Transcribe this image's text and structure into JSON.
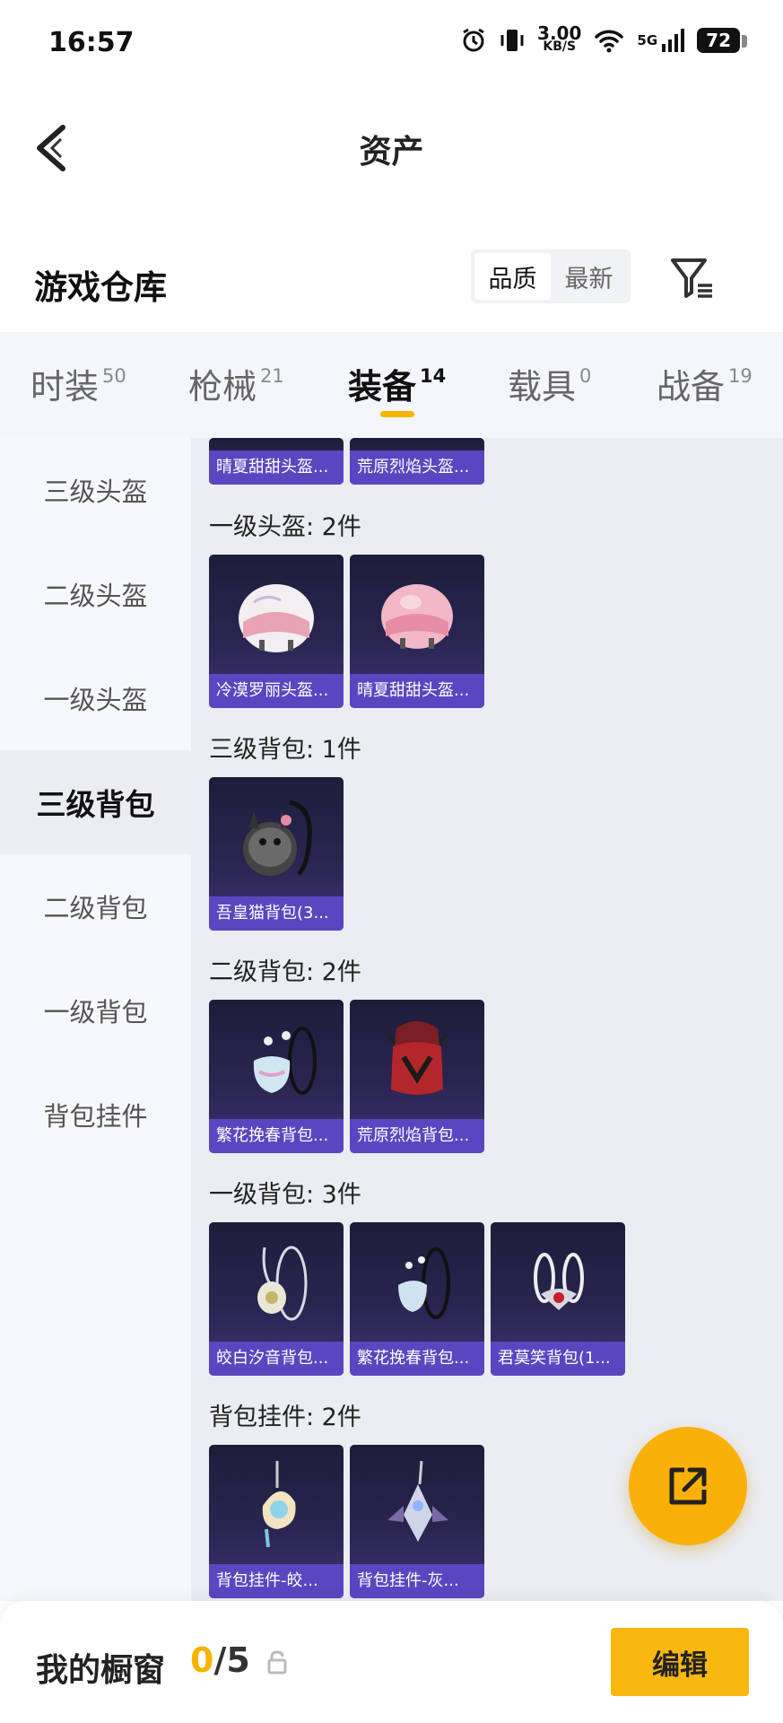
{
  "status_bar": {
    "time": "16:57",
    "speed_value": "3.00",
    "speed_unit": "KB/S",
    "network": "5G",
    "battery": "72"
  },
  "header": {
    "title": "资产",
    "back_icon": "chevron-left-icon"
  },
  "section": {
    "title": "游戏仓库",
    "sort_options": [
      "品质",
      "最新"
    ],
    "sort_selected": "品质",
    "filter_icon": "filter-icon"
  },
  "tabs": [
    {
      "label": "时装",
      "count": "50",
      "active": false
    },
    {
      "label": "枪械",
      "count": "21",
      "active": false
    },
    {
      "label": "装备",
      "count": "14",
      "active": true
    },
    {
      "label": "载具",
      "count": "0",
      "active": false
    },
    {
      "label": "战备",
      "count": "19",
      "active": false
    }
  ],
  "sidebar": {
    "items": [
      "三级头盔",
      "二级头盔",
      "一级头盔",
      "三级背包",
      "二级背包",
      "一级背包",
      "背包挂件"
    ],
    "selected": "三级背包"
  },
  "content": {
    "partial_cards": [
      "晴夏甜甜头盔...",
      "荒原烈焰头盔..."
    ],
    "groups": [
      {
        "label": "一级头盔: 2件",
        "items": [
          "冷漠罗丽头盔...",
          "晴夏甜甜头盔..."
        ]
      },
      {
        "label": "三级背包: 1件",
        "items": [
          "吾皇猫背包(3..."
        ]
      },
      {
        "label": "二级背包: 2件",
        "items": [
          "繁花挽春背包...",
          "荒原烈焰背包..."
        ]
      },
      {
        "label": "一级背包: 3件",
        "items": [
          "皎白汐音背包...",
          "繁花挽春背包...",
          "君莫笑背包(1..."
        ]
      },
      {
        "label": "背包挂件: 2件",
        "items": [
          "背包挂件-皎...",
          "背包挂件-灰..."
        ]
      }
    ]
  },
  "fab": {
    "icon": "share-external-icon"
  },
  "bottom_bar": {
    "label": "我的橱窗",
    "current": "0",
    "total": "/5",
    "lock_icon": "lock-icon",
    "edit_label": "编辑"
  },
  "colors": {
    "accent": "#f9b80f",
    "card_label": "#5b46c1",
    "card_bg": "#24224a"
  }
}
